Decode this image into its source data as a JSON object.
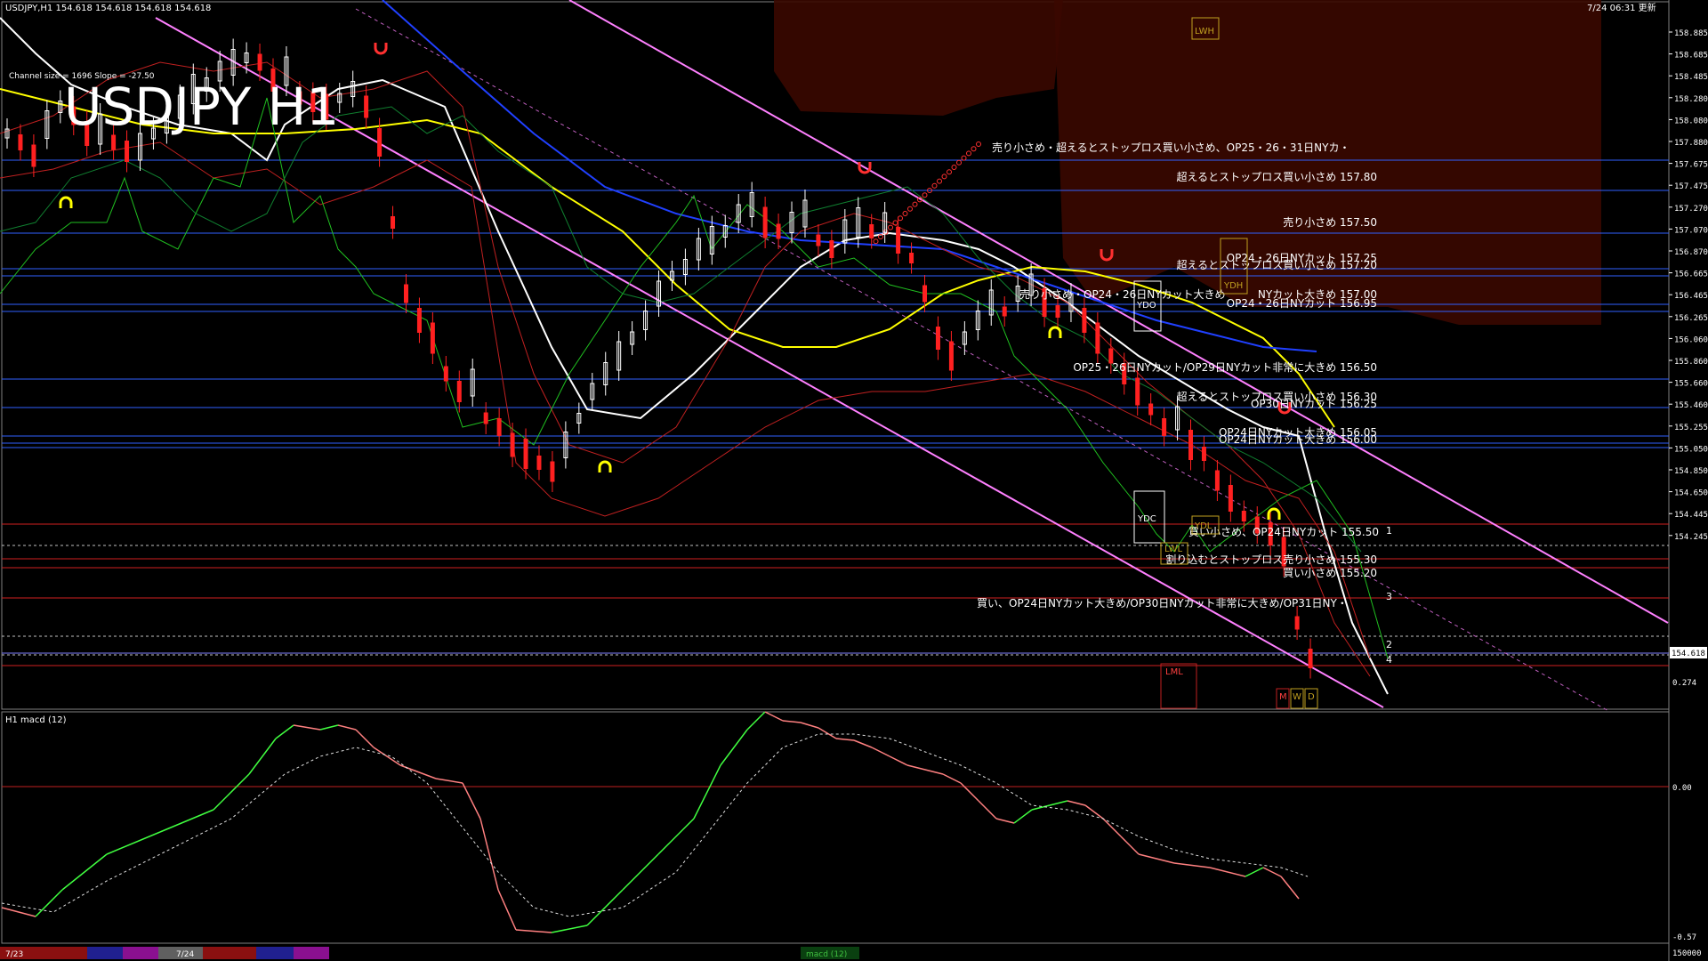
{
  "header": {
    "symbol_info": "USDJPY,H1  154.618 154.618 154.618 154.618",
    "timestamp": "7/24 06:31 更新",
    "channel_info": "Channel size = 1696  Slope = -27.50",
    "watermark": "USDJPY H1"
  },
  "price_axis": {
    "ticks": [
      "158.885",
      "158.685",
      "158.485",
      "158.280",
      "158.080",
      "157.880",
      "157.675",
      "157.475",
      "157.270",
      "157.070",
      "156.870",
      "156.665",
      "156.465",
      "156.265",
      "156.060",
      "155.860",
      "155.660",
      "155.460",
      "155.255",
      "155.050",
      "154.850",
      "154.650",
      "154.445",
      "154.245"
    ],
    "current_price": "154.618"
  },
  "annotations": [
    "売り小さめ・超えるとストップロス買い小さめ、OP25・26・31日NYカ・",
    "超えるとストップロス買い小さめ 157.80",
    "売り小さめ 157.50",
    "OP24・26日NYカット 157.25",
    "超えるとストップロス買い小さめ 157.20",
    "売り小さめ・OP24・26日NYカット大きめ",
    "NYカット大きめ 157.00",
    "OP24・26日NYカット 156.95",
    "OP25・26日NYカット/OP29日NYカット非常に大きめ 156.50",
    "超えるとストップロス買い小さめ 156.30",
    "OP30日NYカット 156.25",
    "OP24日NYカット大きめ 156.05",
    "OP24日NYカット大きめ 156.00",
    "買い小さめ、OP24日NYカット 155.50",
    "割り込むとストップロス売り小さめ 155.30",
    "買い小さめ 155.20",
    "買い、OP24日NYカット大きめ/OP30日NYカット非常に大きめ/OP31日NY・"
  ],
  "markers": {
    "lwh": "LWH",
    "ydh": "YDH",
    "ydo": "YDO",
    "ydc": "YDC",
    "ydl": "YDL",
    "lwl": "LWL",
    "lml": "LML",
    "m": "M",
    "w": "W",
    "d": "D",
    "n1": "1",
    "n2": "2",
    "n3": "3",
    "n4": "4"
  },
  "macd": {
    "title": "H1  macd (12)",
    "ticks": [
      "0.274",
      "0.00",
      "-0.57"
    ],
    "bottom_tick": "150000"
  },
  "time_axis": {
    "labels": [
      "7/23",
      "7/24"
    ],
    "macd_tag": "macd (12)"
  },
  "colors": {
    "background": "#000000",
    "bull_candle": "#ffffff",
    "bear_candle": "#ff2020",
    "ichimoku_cloud": "#c8321e",
    "ma_fast": "#ffffff",
    "ma_mid": "#ffff00",
    "ma_slow": "#2040ff",
    "channel": "#ff80ff",
    "macd_up": "#40ff40",
    "macd_down": "#ff8080",
    "level_blue": "#3060ff",
    "level_red": "#d02020"
  }
}
